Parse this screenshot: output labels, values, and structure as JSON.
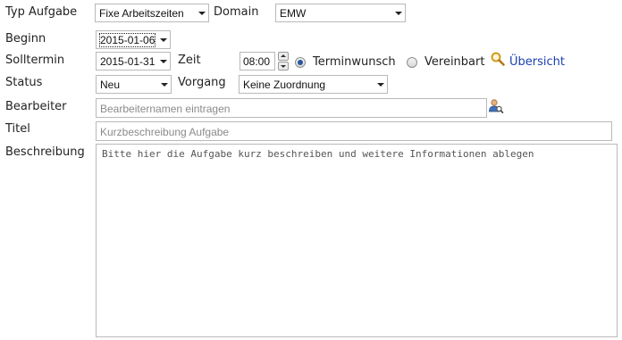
{
  "typ_aufgabe": {
    "label": "Typ Aufgabe",
    "value": "Fixe Arbeitszeiten"
  },
  "domain": {
    "label": "Domain",
    "value": "EMW"
  },
  "beginn": {
    "label": "Beginn",
    "value": "2015-01-06"
  },
  "solltermin": {
    "label": "Solltermin",
    "value": "2015-01-31"
  },
  "zeit": {
    "label": "Zeit",
    "value": "08:00"
  },
  "terminwunsch": {
    "label": "Terminwunsch",
    "checked": true
  },
  "vereinbart": {
    "label": "Vereinbart",
    "checked": false
  },
  "uebersicht": {
    "label": "Übersicht",
    "icon": "magnifier-icon"
  },
  "status": {
    "label": "Status",
    "value": "Neu"
  },
  "vorgang": {
    "label": "Vorgang",
    "value": "Keine Zuordnung"
  },
  "bearbeiter": {
    "label": "Bearbeiter",
    "placeholder": "Bearbeiternamen eintragen",
    "icon": "user-search-icon"
  },
  "titel": {
    "label": "Titel",
    "placeholder": "Kurzbeschreibung Aufgabe"
  },
  "beschreibung": {
    "label": "Beschreibung",
    "placeholder": "Bitte hier die Aufgabe kurz beschreiben und weitere Informationen ablegen"
  },
  "colors": {
    "link": "#1a3fb0",
    "border": "#b9b9b9",
    "radio_checked": "#2a55a0"
  }
}
